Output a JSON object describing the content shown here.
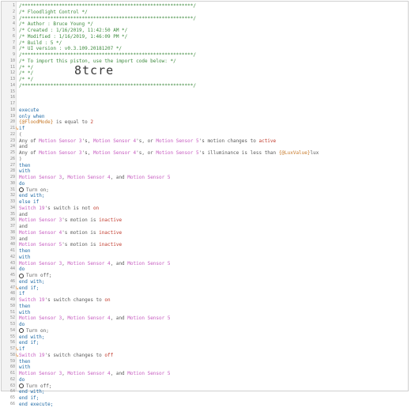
{
  "header_comment": [
    "/************************************************************/",
    "/* Floodlight Control                                       */",
    "/************************************************************/",
    "/* Author      : Bruce Young                                */",
    "/* Created     : 1/16/2019, 11:42:50 AM                      */",
    "/* Modified    : 1/16/2019, 1:46:09 PM                       */",
    "/* Build       : 5                                          */",
    "/* UI version  : v0.3.109.20181207                          */",
    "/************************************************************/",
    "/* To import this piston, use the import code below:       */",
    "/*                                                          */",
    "/*                                                          */",
    "/*                                                          */",
    "/************************************************************/"
  ],
  "import_code": "8tcre",
  "code_lines": [
    {
      "n": "15",
      "t": [
        {
          "c": "",
          "v": ""
        }
      ]
    },
    {
      "n": "16",
      "t": [
        {
          "c": "",
          "v": ""
        }
      ]
    },
    {
      "n": "17",
      "t": [
        {
          "c": "",
          "v": ""
        }
      ]
    },
    {
      "n": "18",
      "t": [
        {
          "c": "kw",
          "v": "execute"
        }
      ]
    },
    {
      "n": "19",
      "t": [
        {
          "c": "",
          "v": "  "
        },
        {
          "c": "kw",
          "v": "only when"
        }
      ]
    },
    {
      "n": "20",
      "t": [
        {
          "c": "",
          "v": "    "
        },
        {
          "c": "var",
          "v": "{@FloodMode}"
        },
        {
          "c": "",
          "v": " is equal to "
        },
        {
          "c": "str",
          "v": "2"
        }
      ]
    },
    {
      "n": "21",
      "t": [
        {
          "c": "",
          "v": "  "
        },
        {
          "c": "kw",
          "v": "if"
        }
      ]
    },
    {
      "n": "22",
      "t": [
        {
          "c": "",
          "v": "      ("
        }
      ]
    },
    {
      "n": "23",
      "t": [
        {
          "c": "",
          "v": "        Any of "
        },
        {
          "c": "dev",
          "v": "Motion Sensor 3"
        },
        {
          "c": "",
          "v": "'s, "
        },
        {
          "c": "dev",
          "v": "Motion Sensor 4"
        },
        {
          "c": "",
          "v": "'s, or "
        },
        {
          "c": "dev",
          "v": "Motion Sensor 5"
        },
        {
          "c": "",
          "v": "'s motion changes to "
        },
        {
          "c": "str",
          "v": "active"
        }
      ]
    },
    {
      "n": "24",
      "t": [
        {
          "c": "",
          "v": "        and"
        }
      ]
    },
    {
      "n": "25",
      "t": [
        {
          "c": "",
          "v": "        Any of "
        },
        {
          "c": "dev",
          "v": "Motion Sensor 3"
        },
        {
          "c": "",
          "v": "'s, "
        },
        {
          "c": "dev",
          "v": "Motion Sensor 4"
        },
        {
          "c": "",
          "v": "'s, or "
        },
        {
          "c": "dev",
          "v": "Motion Sensor 5"
        },
        {
          "c": "",
          "v": "'s illuminance is less than "
        },
        {
          "c": "var",
          "v": "{@LuxValue}"
        },
        {
          "c": "",
          "v": "lux"
        }
      ]
    },
    {
      "n": "26",
      "t": [
        {
          "c": "",
          "v": "      )"
        }
      ]
    },
    {
      "n": "27",
      "t": [
        {
          "c": "",
          "v": "  "
        },
        {
          "c": "kw",
          "v": "then"
        }
      ]
    },
    {
      "n": "28",
      "t": [
        {
          "c": "",
          "v": "      "
        },
        {
          "c": "kw",
          "v": "with"
        }
      ]
    },
    {
      "n": "29",
      "t": [
        {
          "c": "",
          "v": "        "
        },
        {
          "c": "dev",
          "v": "Motion Sensor 3"
        },
        {
          "c": "",
          "v": ", "
        },
        {
          "c": "dev",
          "v": "Motion Sensor 4"
        },
        {
          "c": "",
          "v": ", and "
        },
        {
          "c": "dev",
          "v": "Motion Sensor 5"
        }
      ]
    },
    {
      "n": "30",
      "t": [
        {
          "c": "",
          "v": "      "
        },
        {
          "c": "kw",
          "v": "do"
        }
      ]
    },
    {
      "n": "31",
      "t": [
        {
          "c": "",
          "v": "        "
        },
        {
          "c": "icon",
          "v": ""
        },
        {
          "c": "",
          "v": "Turn on;"
        }
      ]
    },
    {
      "n": "32",
      "t": [
        {
          "c": "",
          "v": "      "
        },
        {
          "c": "kw",
          "v": "end with;"
        }
      ]
    },
    {
      "n": "33",
      "t": [
        {
          "c": "",
          "v": "  "
        },
        {
          "c": "kw",
          "v": "else if"
        }
      ]
    },
    {
      "n": "34",
      "t": [
        {
          "c": "",
          "v": "    "
        },
        {
          "c": "dev",
          "v": "Switch 19"
        },
        {
          "c": "",
          "v": "'s switch is not "
        },
        {
          "c": "str",
          "v": "on"
        }
      ]
    },
    {
      "n": "35",
      "t": [
        {
          "c": "",
          "v": "    and"
        }
      ]
    },
    {
      "n": "36",
      "t": [
        {
          "c": "",
          "v": "    "
        },
        {
          "c": "dev",
          "v": "Motion Sensor 3"
        },
        {
          "c": "",
          "v": "'s motion is "
        },
        {
          "c": "str",
          "v": "inactive"
        }
      ]
    },
    {
      "n": "37",
      "t": [
        {
          "c": "",
          "v": "    and"
        }
      ]
    },
    {
      "n": "38",
      "t": [
        {
          "c": "",
          "v": "    "
        },
        {
          "c": "dev",
          "v": "Motion Sensor 4"
        },
        {
          "c": "",
          "v": "'s motion is "
        },
        {
          "c": "str",
          "v": "inactive"
        }
      ]
    },
    {
      "n": "39",
      "t": [
        {
          "c": "",
          "v": "    and"
        }
      ]
    },
    {
      "n": "40",
      "t": [
        {
          "c": "",
          "v": "    "
        },
        {
          "c": "dev",
          "v": "Motion Sensor 5"
        },
        {
          "c": "",
          "v": "'s motion is "
        },
        {
          "c": "str",
          "v": "inactive"
        }
      ]
    },
    {
      "n": "41",
      "t": [
        {
          "c": "",
          "v": "  "
        },
        {
          "c": "kw",
          "v": "then"
        }
      ]
    },
    {
      "n": "42",
      "t": [
        {
          "c": "",
          "v": "      "
        },
        {
          "c": "kw",
          "v": "with"
        }
      ]
    },
    {
      "n": "43",
      "t": [
        {
          "c": "",
          "v": "        "
        },
        {
          "c": "dev",
          "v": "Motion Sensor 3"
        },
        {
          "c": "",
          "v": ", "
        },
        {
          "c": "dev",
          "v": "Motion Sensor 4"
        },
        {
          "c": "",
          "v": ", and "
        },
        {
          "c": "dev",
          "v": "Motion Sensor 5"
        }
      ]
    },
    {
      "n": "44",
      "t": [
        {
          "c": "",
          "v": "      "
        },
        {
          "c": "kw",
          "v": "do"
        }
      ]
    },
    {
      "n": "45",
      "t": [
        {
          "c": "",
          "v": "        "
        },
        {
          "c": "icon",
          "v": ""
        },
        {
          "c": "",
          "v": "Turn off;"
        }
      ]
    },
    {
      "n": "46",
      "t": [
        {
          "c": "",
          "v": "      "
        },
        {
          "c": "kw",
          "v": "end with;"
        }
      ]
    },
    {
      "n": "47",
      "t": [
        {
          "c": "",
          "v": "  "
        },
        {
          "c": "kw",
          "v": "end if;"
        }
      ]
    },
    {
      "n": "48",
      "t": [
        {
          "c": "",
          "v": "  "
        },
        {
          "c": "kw",
          "v": "if"
        }
      ]
    },
    {
      "n": "49",
      "t": [
        {
          "c": "",
          "v": "    "
        },
        {
          "c": "dev",
          "v": "Switch 19"
        },
        {
          "c": "",
          "v": "'s switch changes to "
        },
        {
          "c": "str",
          "v": "on"
        }
      ]
    },
    {
      "n": "50",
      "t": [
        {
          "c": "",
          "v": "  "
        },
        {
          "c": "kw",
          "v": "then"
        }
      ]
    },
    {
      "n": "51",
      "t": [
        {
          "c": "",
          "v": "      "
        },
        {
          "c": "kw",
          "v": "with"
        }
      ]
    },
    {
      "n": "52",
      "t": [
        {
          "c": "",
          "v": "        "
        },
        {
          "c": "dev",
          "v": "Motion Sensor 3"
        },
        {
          "c": "",
          "v": ", "
        },
        {
          "c": "dev",
          "v": "Motion Sensor 4"
        },
        {
          "c": "",
          "v": ", and "
        },
        {
          "c": "dev",
          "v": "Motion Sensor 5"
        }
      ]
    },
    {
      "n": "53",
      "t": [
        {
          "c": "",
          "v": "      "
        },
        {
          "c": "kw",
          "v": "do"
        }
      ]
    },
    {
      "n": "54",
      "t": [
        {
          "c": "",
          "v": "        "
        },
        {
          "c": "icon",
          "v": ""
        },
        {
          "c": "",
          "v": "Turn on;"
        }
      ]
    },
    {
      "n": "55",
      "t": [
        {
          "c": "",
          "v": "      "
        },
        {
          "c": "kw",
          "v": "end with;"
        }
      ]
    },
    {
      "n": "56",
      "t": [
        {
          "c": "",
          "v": "  "
        },
        {
          "c": "kw",
          "v": "end if;"
        }
      ]
    },
    {
      "n": "57",
      "t": [
        {
          "c": "",
          "v": "  "
        },
        {
          "c": "kw",
          "v": "if"
        }
      ]
    },
    {
      "n": "58",
      "t": [
        {
          "c": "",
          "v": "    "
        },
        {
          "c": "dev",
          "v": "Switch 19"
        },
        {
          "c": "",
          "v": "'s switch changes to "
        },
        {
          "c": "str",
          "v": "off"
        }
      ]
    },
    {
      "n": "59",
      "t": [
        {
          "c": "",
          "v": "  "
        },
        {
          "c": "kw",
          "v": "then"
        }
      ]
    },
    {
      "n": "60",
      "t": [
        {
          "c": "",
          "v": "      "
        },
        {
          "c": "kw",
          "v": "with"
        }
      ]
    },
    {
      "n": "61",
      "t": [
        {
          "c": "",
          "v": "        "
        },
        {
          "c": "dev",
          "v": "Motion Sensor 3"
        },
        {
          "c": "",
          "v": ", "
        },
        {
          "c": "dev",
          "v": "Motion Sensor 4"
        },
        {
          "c": "",
          "v": ", and "
        },
        {
          "c": "dev",
          "v": "Motion Sensor 5"
        }
      ]
    },
    {
      "n": "62",
      "t": [
        {
          "c": "",
          "v": "      "
        },
        {
          "c": "kw",
          "v": "do"
        }
      ]
    },
    {
      "n": "63",
      "t": [
        {
          "c": "",
          "v": "        "
        },
        {
          "c": "icon",
          "v": ""
        },
        {
          "c": "",
          "v": "Turn off;"
        }
      ]
    },
    {
      "n": "64",
      "t": [
        {
          "c": "",
          "v": "      "
        },
        {
          "c": "kw",
          "v": "end with;"
        }
      ]
    },
    {
      "n": "65",
      "t": [
        {
          "c": "",
          "v": "  "
        },
        {
          "c": "kw",
          "v": "end if;"
        }
      ]
    },
    {
      "n": "66",
      "t": [
        {
          "c": "kw",
          "v": "end execute;"
        }
      ]
    }
  ],
  "flag_lines": [
    "21",
    "47",
    "57",
    "58"
  ],
  "colors": {
    "keyword": "#1f6aa5",
    "device": "#c65bc0",
    "string": "#c0392b",
    "variable": "#c77a2a",
    "comment": "#3d8a3d",
    "flag": "#e07a1a"
  }
}
